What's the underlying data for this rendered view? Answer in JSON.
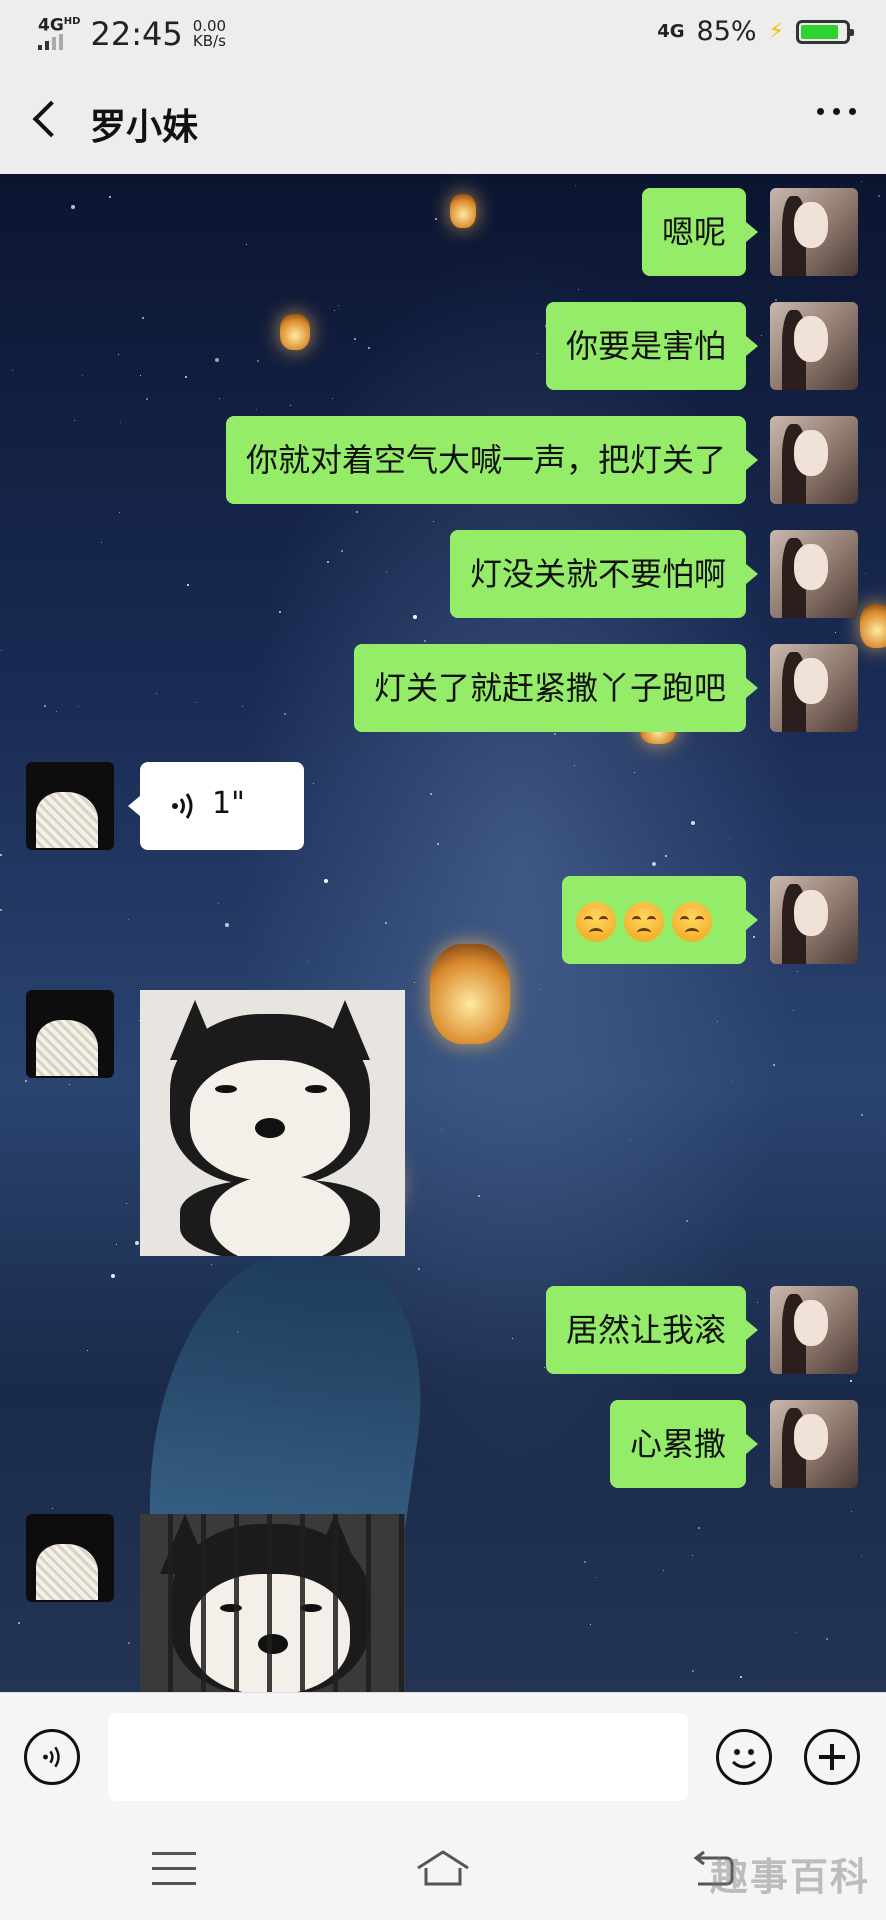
{
  "status_bar": {
    "network_left": "4G",
    "network_left_sup": "HD",
    "time": "22:45",
    "speed_value": "0.00",
    "speed_unit": "KB/s",
    "network_right": "4G",
    "battery_percent": "85%",
    "battery_level": 0.85,
    "charging": true
  },
  "header": {
    "back_icon": "chevron-left-icon",
    "title": "罗小妹",
    "more_icon": "more-dots-icon"
  },
  "messages": [
    {
      "side": "self",
      "type": "text",
      "text": "嗯呢"
    },
    {
      "side": "self",
      "type": "text",
      "text": "你要是害怕"
    },
    {
      "side": "self",
      "type": "text",
      "text": "你就对着空气大喊一声，把灯关了"
    },
    {
      "side": "self",
      "type": "text",
      "text": "灯没关就不要怕啊"
    },
    {
      "side": "self",
      "type": "text",
      "text": "灯关了就赶紧撒丫子跑吧"
    },
    {
      "side": "other",
      "type": "voice",
      "duration": "1\""
    },
    {
      "side": "self",
      "type": "emoji",
      "emoji_count": 3,
      "emoji_name": "sad-face-emoji"
    },
    {
      "side": "other",
      "type": "sticker",
      "sticker": "smug-shiba-dog"
    },
    {
      "side": "self",
      "type": "text",
      "text": "居然让我滚"
    },
    {
      "side": "self",
      "type": "text",
      "text": "心累撒"
    },
    {
      "side": "other",
      "type": "sticker",
      "sticker": "caged-shiba-dog"
    }
  ],
  "input_bar": {
    "voice_icon": "voice-input-icon",
    "message_value": "",
    "emoji_icon": "emoji-icon",
    "plus_icon": "plus-icon"
  },
  "nav_bar": {
    "menu_icon": "menu-icon",
    "home_icon": "home-icon",
    "back_icon": "back-icon",
    "watermark": "趣事百科"
  },
  "colors": {
    "self_bubble": "#95ec69",
    "other_bubble": "#ffffff",
    "background": "#ededed"
  }
}
